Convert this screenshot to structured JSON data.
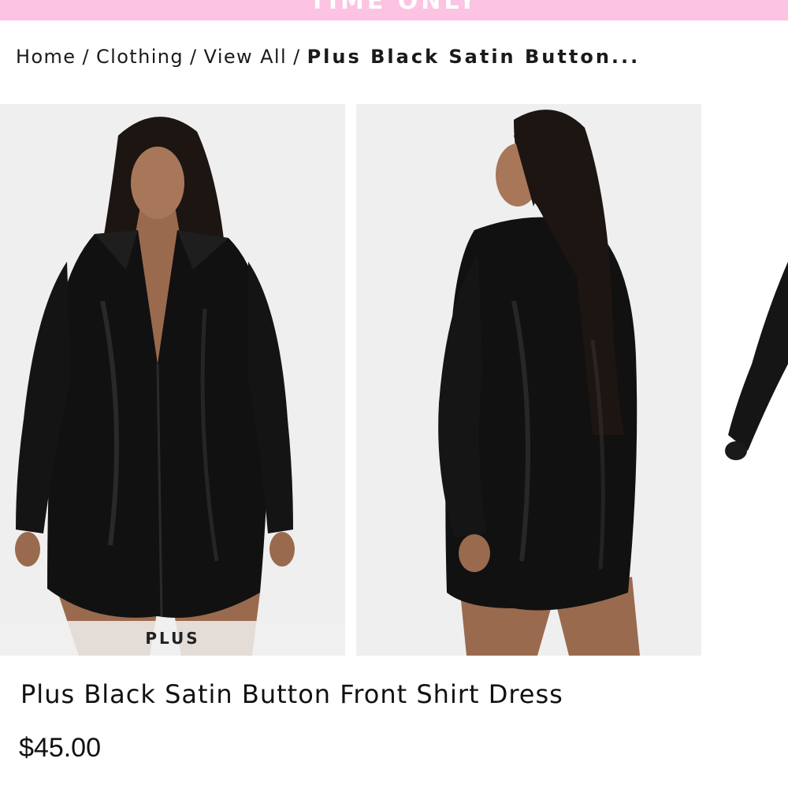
{
  "promo": {
    "text": "TIME ONLY"
  },
  "breadcrumb": {
    "items": [
      {
        "label": "Home"
      },
      {
        "label": "Clothing"
      },
      {
        "label": "View All"
      }
    ],
    "separator": "/",
    "current": "Plus Black Satin Button..."
  },
  "gallery": {
    "badge": "PLUS"
  },
  "product": {
    "title": "Plus Black Satin Button Front Shirt Dress",
    "price": "$45.00"
  },
  "icons": {
    "share": "share-icon"
  },
  "colors": {
    "banner": "#fcc3e3",
    "photo_bg": "#efefef",
    "dress": "#111111"
  }
}
